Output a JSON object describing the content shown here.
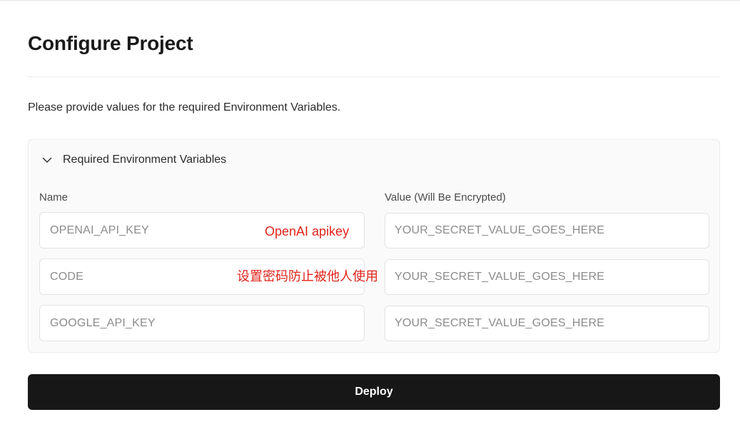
{
  "page": {
    "title": "Configure Project",
    "description": "Please provide values for the required Environment Variables."
  },
  "env_section": {
    "title": "Required Environment Variables",
    "name_column_label": "Name",
    "value_column_label": "Value (Will Be Encrypted)",
    "rows": [
      {
        "name": "OPENAI_API_KEY",
        "value_placeholder": "YOUR_SECRET_VALUE_GOES_HERE"
      },
      {
        "name": "CODE",
        "value_placeholder": "YOUR_SECRET_VALUE_GOES_HERE"
      },
      {
        "name": "GOOGLE_API_KEY",
        "value_placeholder": "YOUR_SECRET_VALUE_GOES_HERE"
      }
    ]
  },
  "annotations": {
    "openai": "OpenAI apikey",
    "code": "设置密码防止被他人使用"
  },
  "deploy_button": {
    "label": "Deploy"
  },
  "colors": {
    "annotation": "#e0241b",
    "button_bg": "#171717",
    "panel_bg": "#fafafa"
  },
  "icons": {
    "section_toggle": "chevron-down-icon"
  }
}
